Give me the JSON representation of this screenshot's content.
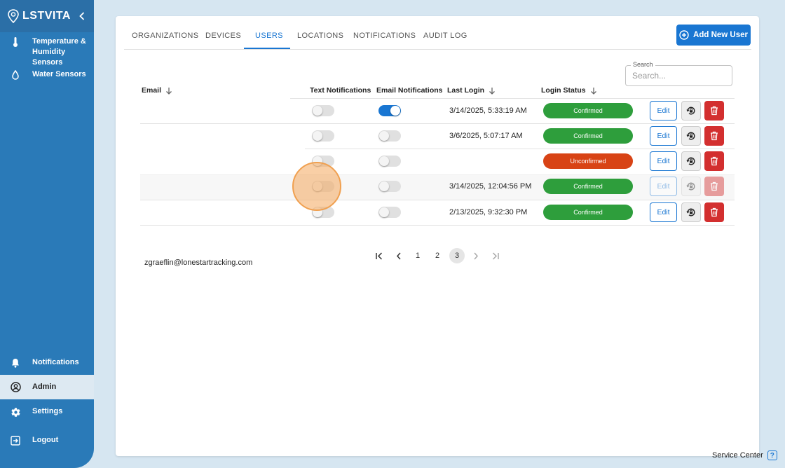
{
  "sidebar": {
    "logo": "LSTVITA",
    "items": [
      {
        "label": "Temperature & Humidity Sensors",
        "icon": "thermometer-icon"
      },
      {
        "label": "Water Sensors",
        "icon": "water-drop-icon"
      },
      {
        "label": "Notifications",
        "icon": "bell-icon"
      },
      {
        "label": "Admin",
        "icon": "user-circle-icon"
      },
      {
        "label": "Settings",
        "icon": "gear-icon"
      },
      {
        "label": "Logout",
        "icon": "logout-icon"
      }
    ],
    "active_item": "Admin"
  },
  "tabs": [
    {
      "label": "ORGANIZATIONS"
    },
    {
      "label": "DEVICES"
    },
    {
      "label": "USERS"
    },
    {
      "label": "LOCATIONS"
    },
    {
      "label": "NOTIFICATIONS"
    },
    {
      "label": "AUDIT LOG"
    }
  ],
  "active_tab": "USERS",
  "add_button": "Add New User",
  "search": {
    "legend": "Search",
    "placeholder": "Search..."
  },
  "table": {
    "headers": {
      "email": "Email",
      "text_notifications": "Text Notifications",
      "email_notifications": "Email Notifications",
      "last_login": "Last Login",
      "login_status": "Login Status"
    },
    "rows": [
      {
        "email": "",
        "text_on": false,
        "email_on": true,
        "last_login": "3/14/2025, 5:33:19 AM",
        "status": "Confirmed",
        "edit": "Edit"
      },
      {
        "email": "",
        "text_on": false,
        "email_on": false,
        "last_login": "3/6/2025, 5:07:17 AM",
        "status": "Confirmed",
        "edit": "Edit"
      },
      {
        "email": "",
        "text_on": false,
        "email_on": false,
        "last_login": "",
        "status": "Unconfirmed",
        "edit": "Edit"
      },
      {
        "email": "zgraeflin@lonestartracking.com",
        "text_on": false,
        "email_on": false,
        "last_login": "3/14/2025, 12:04:56 PM",
        "status": "Confirmed",
        "edit": "Edit"
      },
      {
        "email": "",
        "text_on": false,
        "email_on": false,
        "last_login": "2/13/2025, 9:32:30 PM",
        "status": "Confirmed",
        "edit": "Edit"
      }
    ]
  },
  "pagination": {
    "pages": [
      "1",
      "2",
      "3"
    ],
    "current": "3"
  },
  "footer": {
    "service_center": "Service Center",
    "help": "?"
  },
  "colors": {
    "sidebar": "#2a7ab8",
    "accent": "#1976d2",
    "confirmed": "#2e9e3c",
    "unconfirmed": "#d84315",
    "delete": "#d32f2f"
  }
}
